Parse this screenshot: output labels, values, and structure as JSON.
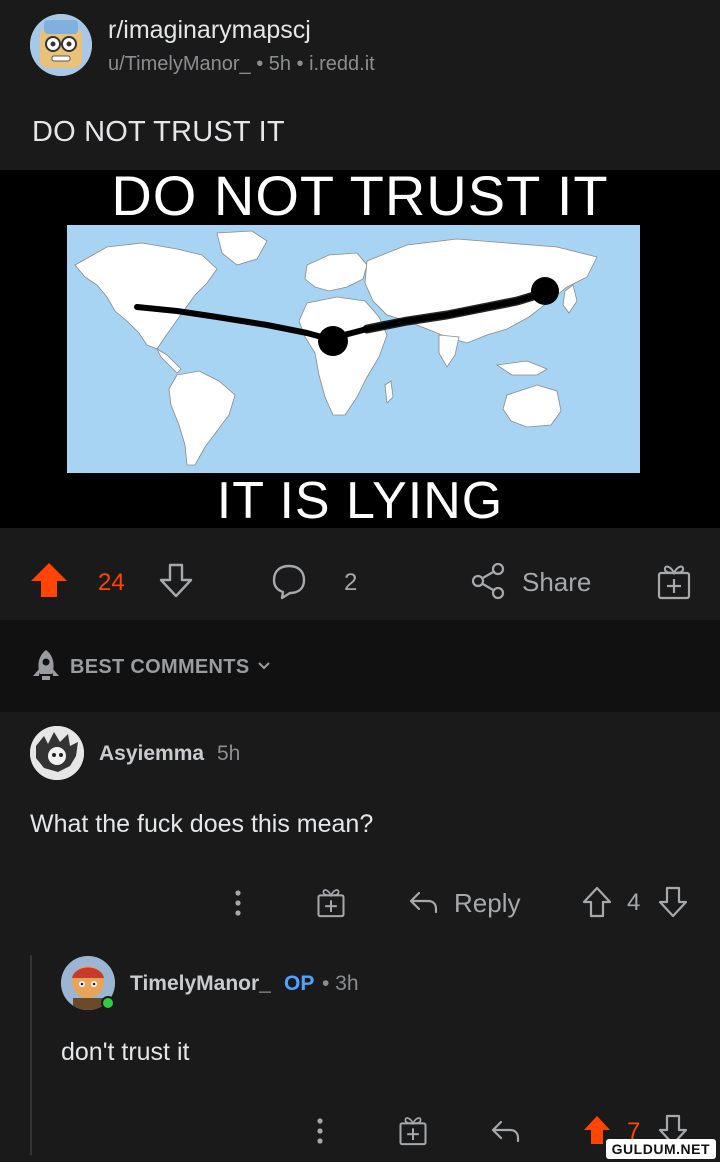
{
  "post": {
    "subreddit": "r/imaginarymapscj",
    "meta": "u/TimelyManor_ • 5h • i.redd.it",
    "title": "DO NOT TRUST IT",
    "image_top_text": "DO NOT TRUST IT",
    "image_bottom_text": "IT IS LYING",
    "upvotes": "24",
    "comments": "2",
    "share_label": "Share",
    "upvote_color": "#ff4500"
  },
  "sort": {
    "label": "BEST COMMENTS"
  },
  "comments": [
    {
      "author": "Asyiemma",
      "time": "5h",
      "body": "What the fuck does this mean?",
      "reply_label": "Reply",
      "score": "4"
    },
    {
      "author": "TimelyManor_",
      "op_badge": "OP",
      "time": "• 3h",
      "body": "don't trust it",
      "score": "7"
    }
  ],
  "watermark": "GULDUM.NET",
  "icons": [
    "subreddit-avatar",
    "upvote-icon",
    "downvote-icon",
    "comment-icon",
    "share-icon",
    "award-icon",
    "rocket-icon",
    "chevron-down-icon",
    "more-icon",
    "reply-icon"
  ]
}
